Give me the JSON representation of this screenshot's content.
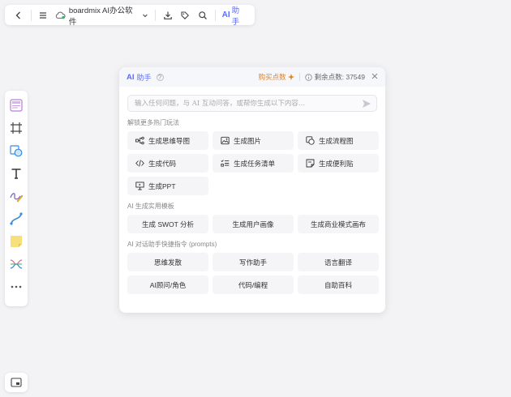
{
  "topbar": {
    "file_name": "boardmix AI办公软件",
    "ai_label": "AI",
    "ai_sub": "助手"
  },
  "panel": {
    "title": "AI",
    "title_sub": "助手",
    "help": "?",
    "buy_points": "购买点数",
    "remaining": "剩余点数: 37549",
    "search_placeholder": "输入任何问题，与 AI 互动问答，或帮你生成以下内容...",
    "sections": [
      {
        "title": "解锁更多热门玩法",
        "items": [
          {
            "label": "生成思维导图",
            "icon": "mindmap-icon"
          },
          {
            "label": "生成图片",
            "icon": "image-icon"
          },
          {
            "label": "生成流程图",
            "icon": "flowchart-icon"
          },
          {
            "label": "生成代码",
            "icon": "code-icon"
          },
          {
            "label": "生成任务清单",
            "icon": "checklist-icon"
          },
          {
            "label": "生成便利贴",
            "icon": "sticky-note-icon"
          },
          {
            "label": "生成PPT",
            "icon": "presentation-icon"
          }
        ]
      },
      {
        "title": "AI 生成实用模板",
        "items": [
          {
            "label": "生成 SWOT 分析"
          },
          {
            "label": "生成用户画像"
          },
          {
            "label": "生成商业模式画布"
          }
        ]
      },
      {
        "title": "AI 对话助手快捷指令 (prompts)",
        "items": [
          {
            "label": "思维发散"
          },
          {
            "label": "写作助手"
          },
          {
            "label": "语言翻译"
          },
          {
            "label": "AI顾问/角色"
          },
          {
            "label": "代码/编程"
          },
          {
            "label": "自助百科"
          }
        ]
      }
    ]
  },
  "colors": {
    "accent": "#5b6cf9",
    "buy": "#e8801d",
    "background": "#f3f3f5"
  }
}
